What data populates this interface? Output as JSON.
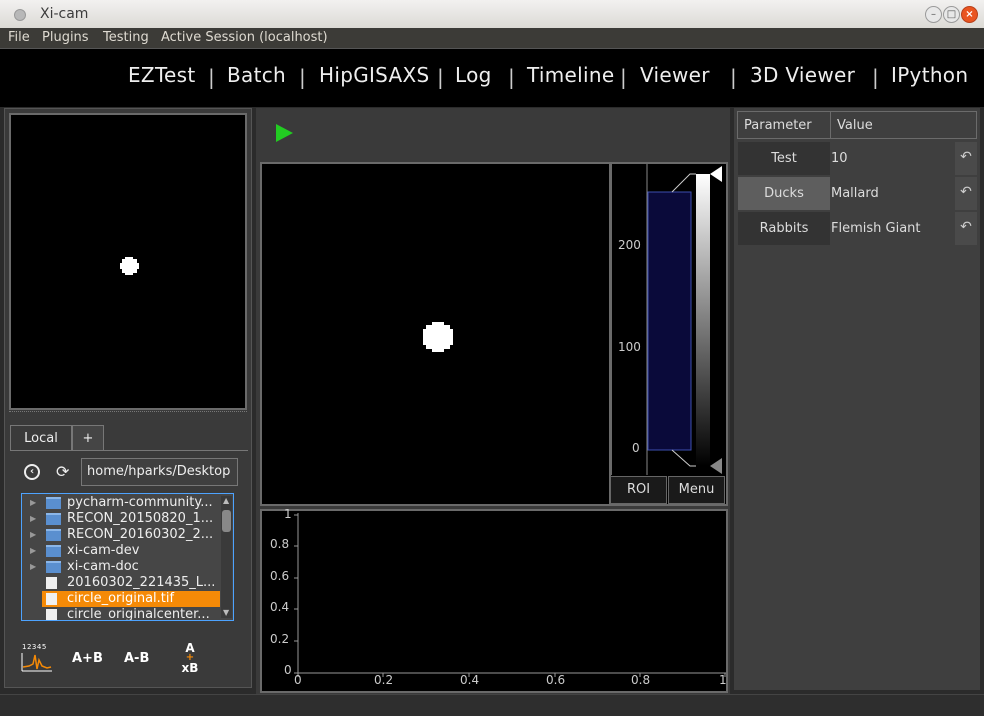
{
  "window": {
    "title": "Xi-cam"
  },
  "menu": [
    "File",
    "Plugins",
    "Testing",
    "Active Session (localhost)"
  ],
  "nav": [
    "EZTest",
    "Batch",
    "HipGISAXS",
    "Log",
    "Timeline",
    "Viewer",
    "3D Viewer",
    "IPython"
  ],
  "browser": {
    "tabs": [
      "Local",
      "+"
    ],
    "path": "home/hparks/Desktop",
    "files": [
      {
        "name": "pycharm-community...",
        "type": "folder"
      },
      {
        "name": "RECON_20150820_1...",
        "type": "folder"
      },
      {
        "name": "RECON_20160302_2...",
        "type": "folder"
      },
      {
        "name": "xi-cam-dev",
        "type": "folder"
      },
      {
        "name": "xi-cam-doc",
        "type": "folder"
      },
      {
        "name": "20160302_221435_L...",
        "type": "file"
      },
      {
        "name": "circle_original.tif",
        "type": "file",
        "selected": true
      },
      {
        "name": "circle_originalcenter...",
        "type": "file"
      }
    ],
    "ops": {
      "plot_top": "12345",
      "add": "A+B",
      "sub": "A-B",
      "mul_a": "A",
      "mul_plus": "+",
      "mul_b": "xB"
    }
  },
  "histogram": {
    "ticks": [
      "200",
      "100",
      "0"
    ],
    "roi_label": "ROI",
    "menu_label": "Menu"
  },
  "plot": {
    "y_ticks": [
      "1",
      "0.8",
      "0.6",
      "0.4",
      "0.2",
      "0"
    ],
    "x_ticks": [
      "0",
      "0.2",
      "0.4",
      "0.6",
      "0.8",
      "1"
    ]
  },
  "params": {
    "header": {
      "param": "Parameter",
      "value": "Value"
    },
    "rows": [
      {
        "label": "Test",
        "value": "10"
      },
      {
        "label": "Ducks",
        "value": "Mallard"
      },
      {
        "label": "Rabbits",
        "value": "Flemish Giant"
      }
    ]
  },
  "colors": {
    "selection": "#f58a07",
    "play": "#22cc22",
    "close": "#e95420",
    "hist_fill": "#0a0a3a"
  },
  "icons": {
    "play": "play-icon",
    "back": "back-icon",
    "refresh": "refresh-icon",
    "reset": "reset-icon"
  }
}
